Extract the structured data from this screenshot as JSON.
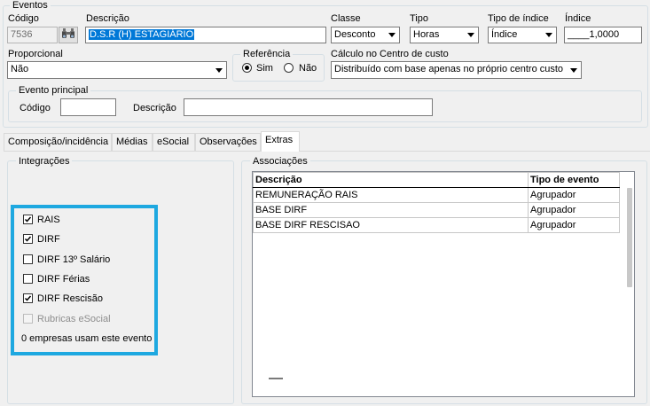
{
  "eventos": {
    "legend": "Eventos",
    "codigo_label": "Código",
    "codigo_value": "7536",
    "descricao_label": "Descrição",
    "descricao_value": "D.S.R (H) ESTAGIÁRIO",
    "classe_label": "Classe",
    "classe_value": "Desconto",
    "tipo_label": "Tipo",
    "tipo_value": "Horas",
    "tipo_indice_label": "Tipo de índice",
    "tipo_indice_value": "Índice",
    "indice_label": "Índice",
    "indice_value": "____1,0000",
    "proporcional_label": "Proporcional",
    "proporcional_value": "Não",
    "referencia_legend": "Referência",
    "referencia_sim": "Sim",
    "referencia_nao": "Não",
    "referencia_selected": "Sim",
    "calculo_label": "Cálculo no Centro de custo",
    "calculo_value": "Distribuído com base apenas no próprio centro custo",
    "evento_principal_legend": "Evento principal",
    "ep_codigo_label": "Código",
    "ep_codigo_value": "",
    "ep_descricao_label": "Descrição",
    "ep_descricao_value": ""
  },
  "tabs": [
    {
      "label": "Composição/incidência"
    },
    {
      "label": "Médias"
    },
    {
      "label": "eSocial"
    },
    {
      "label": "Observações"
    },
    {
      "label": "Extras"
    }
  ],
  "active_tab": "Extras",
  "integracoes": {
    "legend": "Integrações",
    "items": [
      {
        "label": "RAIS",
        "checked": true,
        "enabled": true
      },
      {
        "label": "DIRF",
        "checked": true,
        "enabled": true
      },
      {
        "label": "DIRF 13º Salário",
        "checked": false,
        "enabled": true
      },
      {
        "label": "DIRF Férias",
        "checked": false,
        "enabled": true
      },
      {
        "label": "DIRF Rescisão",
        "checked": true,
        "enabled": true
      },
      {
        "label": "Rubricas eSocial",
        "checked": false,
        "enabled": false
      }
    ],
    "footer_text": "0 empresas usam este evento"
  },
  "associacoes": {
    "legend": "Associações",
    "columns": [
      "Descrição",
      "Tipo de evento"
    ],
    "rows": [
      [
        "REMUNERAÇÃO RAIS",
        "Agrupador"
      ],
      [
        "BASE DIRF",
        "Agrupador"
      ],
      [
        "BASE DIRF RESCISAO",
        "Agrupador"
      ]
    ]
  },
  "colors": {
    "highlight": "#1ea8e0",
    "selection": "#0078d7"
  }
}
